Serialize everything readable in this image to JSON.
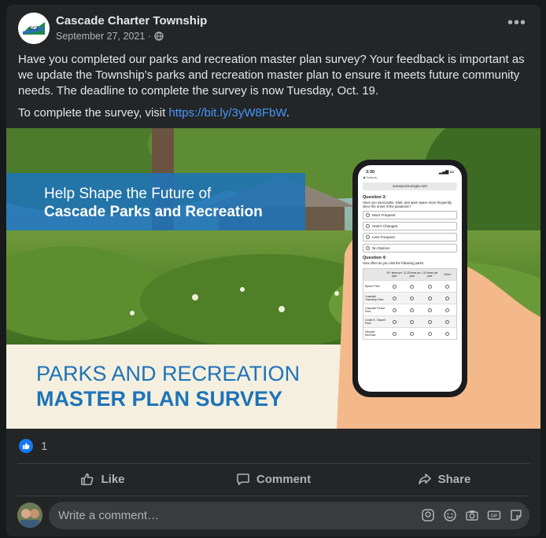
{
  "post": {
    "page_name": "Cascade Charter Township",
    "date": "September 27, 2021 ·",
    "paragraph1": "Have you completed our parks and recreation master plan survey? Your feedback is important as we update the Township’s parks and recreation master plan to ensure it meets future community needs. The deadline to complete the survey is now Tuesday, Oct. 19.",
    "paragraph2_prefix": "To complete the survey, visit ",
    "link": "https://bit.ly/3yW8FbW",
    "paragraph2_suffix": "."
  },
  "hero": {
    "banner_line1": "Help Shape the Future of",
    "banner_line2": "Cascade Parks and Recreation",
    "title_line1": "PARKS AND RECREATION",
    "title_line2": "MASTER PLAN SURVEY",
    "phone": {
      "time": "3:30",
      "back": "◀ Outlook",
      "url": "survey123.arcgis.com",
      "q3_title": "Question 3:",
      "q3_text": "Have you used parks, trails, and open space more frequently since the onset of the pandemic?",
      "q3_options": [
        "More Frequent",
        "Hasn't Changed",
        "Less Frequent",
        "No Opinion"
      ],
      "q4_title": "Question 4:",
      "q4_text": "How often do you visit the following parks:",
      "q4_cols": [
        "20+ times per year",
        "11-25 times per year",
        "1-10 times per year",
        "Never"
      ],
      "q4_rows": [
        "Bynee Park",
        "Cascade Township Park",
        "Cascade Peace Park",
        "Leslie E. Tassell Park",
        "Michael McGraw"
      ]
    }
  },
  "reactions": {
    "count": "1"
  },
  "actions": {
    "like": "Like",
    "comment": "Comment",
    "share": "Share"
  },
  "comment": {
    "placeholder": "Write a comment…"
  },
  "colors": {
    "card": "#242526",
    "accent": "#1877f2",
    "link": "#4599ff",
    "banner": "#1e73b8"
  }
}
